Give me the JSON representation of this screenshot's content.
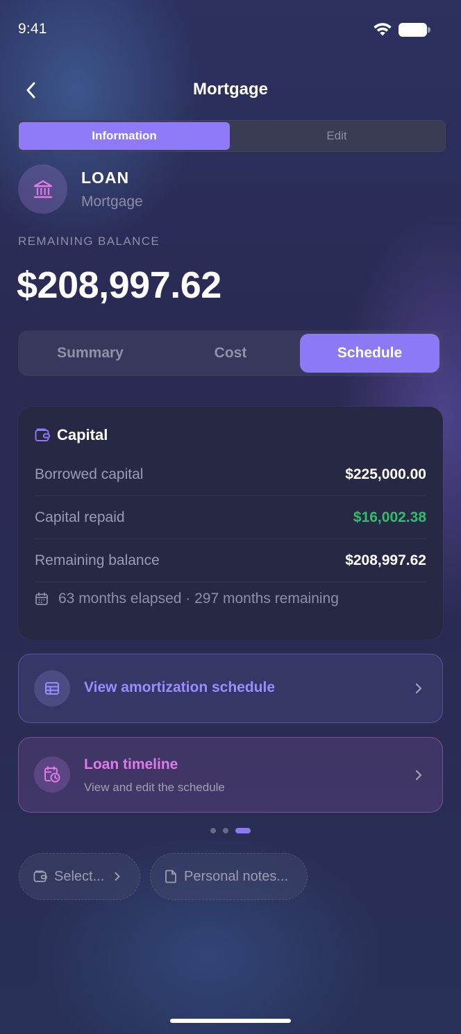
{
  "status_bar": {
    "time": "9:41"
  },
  "nav": {
    "title": "Mortgage"
  },
  "top_segment": {
    "items": [
      "Information",
      "Edit"
    ],
    "selected": "Information"
  },
  "account": {
    "type": "LOAN",
    "name": "Mortgage",
    "icon": "bank-icon"
  },
  "balance": {
    "label": "REMAINING BALANCE",
    "value": "$208,997.62"
  },
  "view_tabs": {
    "items": [
      "Summary",
      "Cost",
      "Schedule"
    ],
    "selected": "Schedule"
  },
  "capital_card": {
    "title": "Capital",
    "rows": [
      {
        "label": "Borrowed capital",
        "value": "$225,000.00"
      },
      {
        "label": "Capital repaid",
        "value": "$16,002.38",
        "color": "#2fbf6a"
      },
      {
        "label": "Remaining balance",
        "value": "$208,997.62"
      }
    ],
    "elapsed": "63 months elapsed · 297 months remaining"
  },
  "actions": {
    "amortization": {
      "title": "View amortization schedule",
      "icon": "table-icon"
    },
    "timeline": {
      "title": "Loan timeline",
      "subtitle": "View and edit the schedule",
      "icon": "calendar-clock-icon"
    }
  },
  "pager": {
    "pages": 3,
    "current": 3
  },
  "chips": {
    "select": "Select...",
    "notes": "Personal notes..."
  },
  "colors": {
    "accent": "#8b79f6",
    "positive": "#2fbf6a",
    "timeline": "#e07ae8",
    "amort": "#9b8cff"
  }
}
